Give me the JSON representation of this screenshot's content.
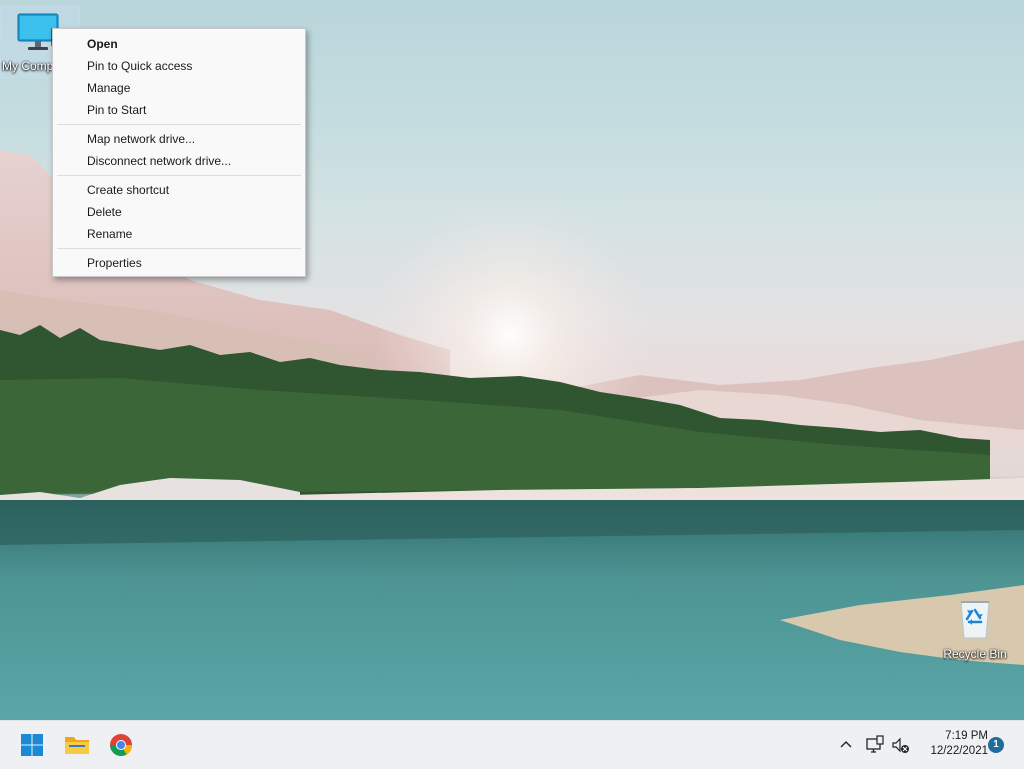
{
  "desktop": {
    "icons": [
      {
        "label": "My Computer",
        "icon": "monitor-icon"
      },
      {
        "label": "Recycle Bin",
        "icon": "recycle-bin-icon"
      }
    ]
  },
  "context_menu": {
    "groups": [
      [
        "Open",
        "Pin to Quick access",
        "Manage",
        "Pin to Start"
      ],
      [
        "Map network drive...",
        "Disconnect network drive..."
      ],
      [
        "Create shortcut",
        "Delete",
        "Rename"
      ],
      [
        "Properties"
      ]
    ],
    "default_item": "Open"
  },
  "taskbar": {
    "apps": [
      {
        "name": "Start",
        "icon": "windows-start-icon"
      },
      {
        "name": "File Explorer",
        "icon": "folder-icon"
      },
      {
        "name": "Google Chrome",
        "icon": "chrome-icon"
      }
    ],
    "tray": {
      "time": "7:19 PM",
      "date": "12/22/2021",
      "notification_count": "1"
    }
  },
  "colors": {
    "accent": "#1f6d99",
    "menu_bg": "#f9f9f9",
    "taskbar_bg": "#eef0f3"
  }
}
